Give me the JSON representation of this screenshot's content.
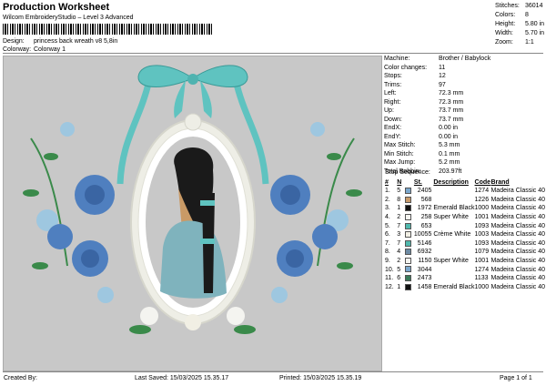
{
  "header": {
    "title": "Production Worksheet",
    "subtitle": "Wilcom EmbroideryStudio – Level 3 Advanced",
    "design_label": "Design:",
    "design_value": "princess back wreath v8 5,8in",
    "colorway_label": "Colorway:",
    "colorway_value": "Colorway 1"
  },
  "stats": [
    {
      "label": "Stitches:",
      "value": "36014"
    },
    {
      "label": "Colors:",
      "value": "8"
    },
    {
      "label": "Height:",
      "value": "5.80 in"
    },
    {
      "label": "Width:",
      "value": "5.70 in"
    },
    {
      "label": "Zoom:",
      "value": "1:1"
    }
  ],
  "props": [
    {
      "label": "Machine:",
      "value": "Brother / Babylock"
    },
    {
      "label": "Color changes:",
      "value": "11"
    },
    {
      "label": "Stops:",
      "value": "12"
    },
    {
      "label": "Trims:",
      "value": "97"
    },
    {
      "label": "Left:",
      "value": "72.3 mm"
    },
    {
      "label": "Right:",
      "value": "72.3 mm"
    },
    {
      "label": "Up:",
      "value": "73.7 mm"
    },
    {
      "label": "Down:",
      "value": "73.7 mm"
    },
    {
      "label": "EndX:",
      "value": "0.00 in"
    },
    {
      "label": "EndY:",
      "value": "0.00 in"
    },
    {
      "label": "Max Stitch:",
      "value": "5.3 mm"
    },
    {
      "label": "Min Stitch:",
      "value": "0.1 mm"
    },
    {
      "label": "Max Jump:",
      "value": "5.2 mm"
    },
    {
      "label": "Total Bobbin:",
      "value": "203.97ft"
    }
  ],
  "stop_sequence": {
    "label": "Stop Sequence:",
    "columns": [
      "#",
      "N",
      "St.",
      "Description",
      "Code",
      "Brand"
    ],
    "rows": [
      {
        "idx": "1.",
        "n": "5",
        "color": "#7ba7cc",
        "st": "2405",
        "desc": "",
        "code": "1274",
        "brand": "Madeira Classic 40"
      },
      {
        "idx": "2.",
        "n": "8",
        "color": "#c79a6b",
        "st": "568",
        "desc": "",
        "code": "1226",
        "brand": "Madeira Classic 40"
      },
      {
        "idx": "3.",
        "n": "1",
        "color": "#111111",
        "st": "1972",
        "desc": "Emerald Black",
        "code": "1000",
        "brand": "Madeira Classic 40"
      },
      {
        "idx": "4.",
        "n": "2",
        "color": "#f4f4f0",
        "st": "258",
        "desc": "Super White",
        "code": "1001",
        "brand": "Madeira Classic 40"
      },
      {
        "idx": "5.",
        "n": "7",
        "color": "#4fb8ad",
        "st": "653",
        "desc": "",
        "code": "1093",
        "brand": "Madeira Classic 40"
      },
      {
        "idx": "6.",
        "n": "3",
        "color": "#f1efe4",
        "st": "10055",
        "desc": "Crème White",
        "code": "1003",
        "brand": "Madeira Classic 40"
      },
      {
        "idx": "7.",
        "n": "7",
        "color": "#4fb8ad",
        "st": "5146",
        "desc": "",
        "code": "1093",
        "brand": "Madeira Classic 40"
      },
      {
        "idx": "8.",
        "n": "4",
        "color": "#6d8aa3",
        "st": "6932",
        "desc": "",
        "code": "1079",
        "brand": "Madeira Classic 40"
      },
      {
        "idx": "9.",
        "n": "2",
        "color": "#f4f4f0",
        "st": "1150",
        "desc": "Super White",
        "code": "1001",
        "brand": "Madeira Classic 40"
      },
      {
        "idx": "10.",
        "n": "5",
        "color": "#7ba7cc",
        "st": "3044",
        "desc": "",
        "code": "1274",
        "brand": "Madeira Classic 40"
      },
      {
        "idx": "11.",
        "n": "6",
        "color": "#3a7a5a",
        "st": "2473",
        "desc": "",
        "code": "1133",
        "brand": "Madeira Classic 40"
      },
      {
        "idx": "12.",
        "n": "1",
        "color": "#111111",
        "st": "1458",
        "desc": "Emerald Black",
        "code": "1000",
        "brand": "Madeira Classic 40"
      }
    ]
  },
  "footer": {
    "created_by": "Created By:",
    "last_saved": "Last Saved: 15/03/2025 15.35.17",
    "printed": "Printed: 15/03/2025 15.35.19",
    "page": "Page 1 of 1"
  },
  "colors": {
    "ribbon": "#5fc3c0",
    "frame": "#eeeee6",
    "rose": "#4f7fbf",
    "leaf": "#3a8a4a",
    "hair": "#1a1a1a",
    "skin": "#c99a66",
    "dress": "#7fb3bd"
  }
}
